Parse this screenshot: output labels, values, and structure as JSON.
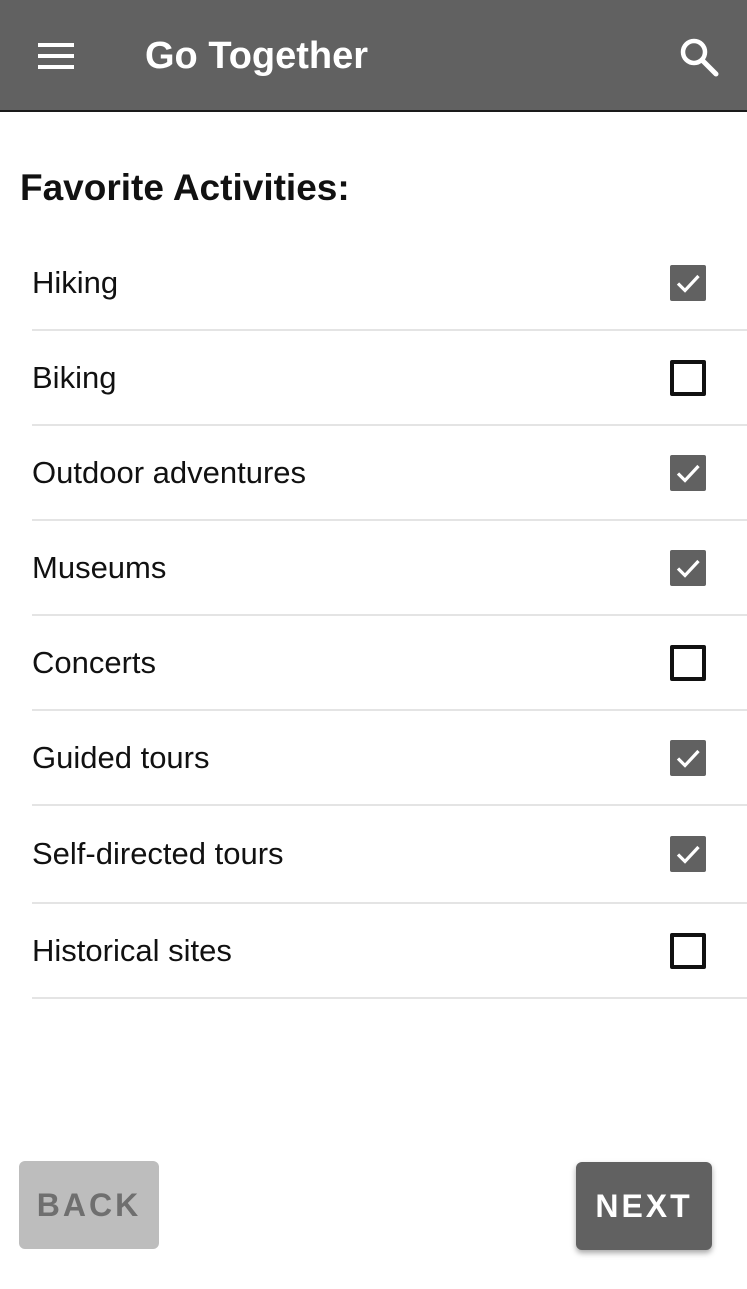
{
  "app_bar": {
    "title": "Go Together",
    "menu_icon": "menu-icon",
    "search_icon": "search-icon",
    "background_color": "#616161"
  },
  "section": {
    "title": "Favorite Activities:"
  },
  "activities": [
    {
      "label": "Hiking",
      "checked": true
    },
    {
      "label": "Biking",
      "checked": false
    },
    {
      "label": "Outdoor adventures",
      "checked": true
    },
    {
      "label": "Museums",
      "checked": true
    },
    {
      "label": "Concerts",
      "checked": false
    },
    {
      "label": "Guided tours",
      "checked": true
    },
    {
      "label": "Self-directed tours",
      "checked": true
    },
    {
      "label": "Historical sites",
      "checked": false
    }
  ],
  "footer": {
    "back_label": "BACK",
    "next_label": "NEXT"
  },
  "colors": {
    "primary": "#616161",
    "disabled_button": "#bdbdbd"
  }
}
